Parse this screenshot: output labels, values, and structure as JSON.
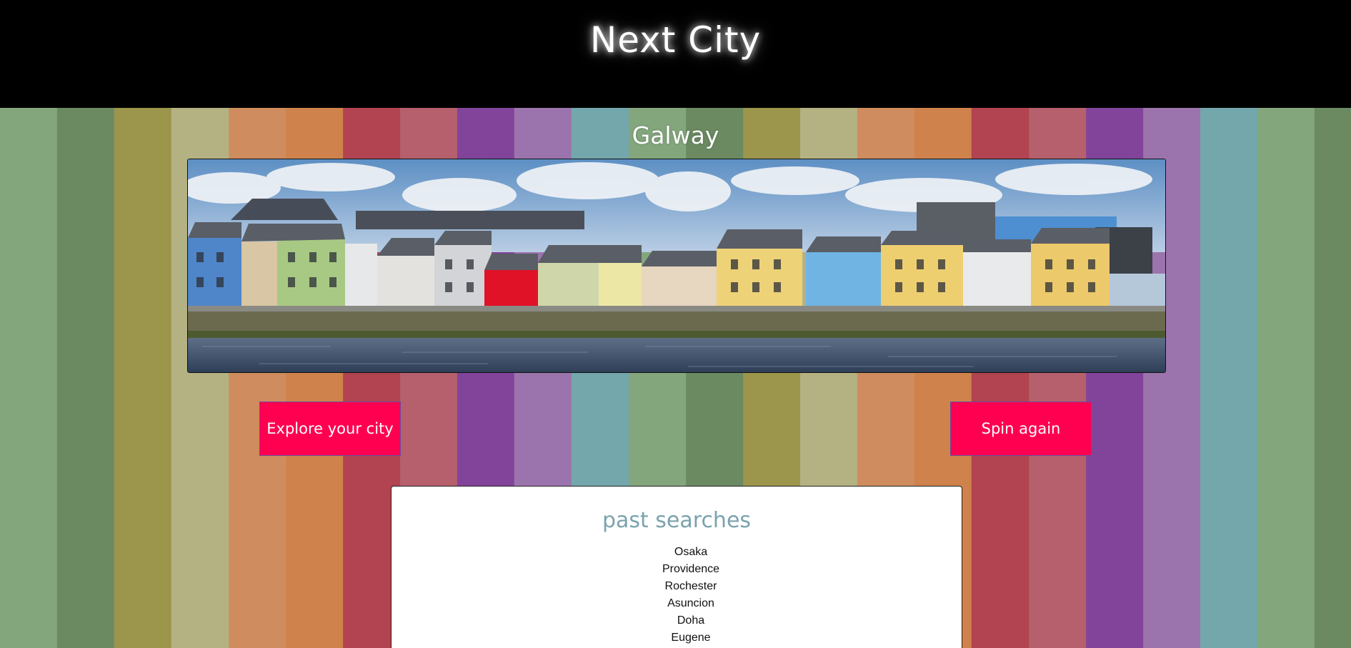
{
  "header": {
    "title": "Next City"
  },
  "city": {
    "name": "Galway",
    "image_icon": "galway-harbour-photo"
  },
  "buttons": {
    "explore_label": "Explore your city",
    "spin_label": "Spin again"
  },
  "past_searches": {
    "title": "past searches",
    "items": [
      "Osaka",
      "Providence",
      "Rochester",
      "Asuncion",
      "Doha",
      "Eugene"
    ]
  },
  "colors": {
    "header_bg": "#000000",
    "button_bg": "#ff0050",
    "past_title": "#7ba3ad",
    "stripes": [
      "#84a67d",
      "#6b8a62",
      "#9c954c",
      "#b4b282",
      "#cf8c5e",
      "#cf824c",
      "#b24351",
      "#b5606c",
      "#82449a",
      "#9c74ad",
      "#73a7ac"
    ]
  }
}
